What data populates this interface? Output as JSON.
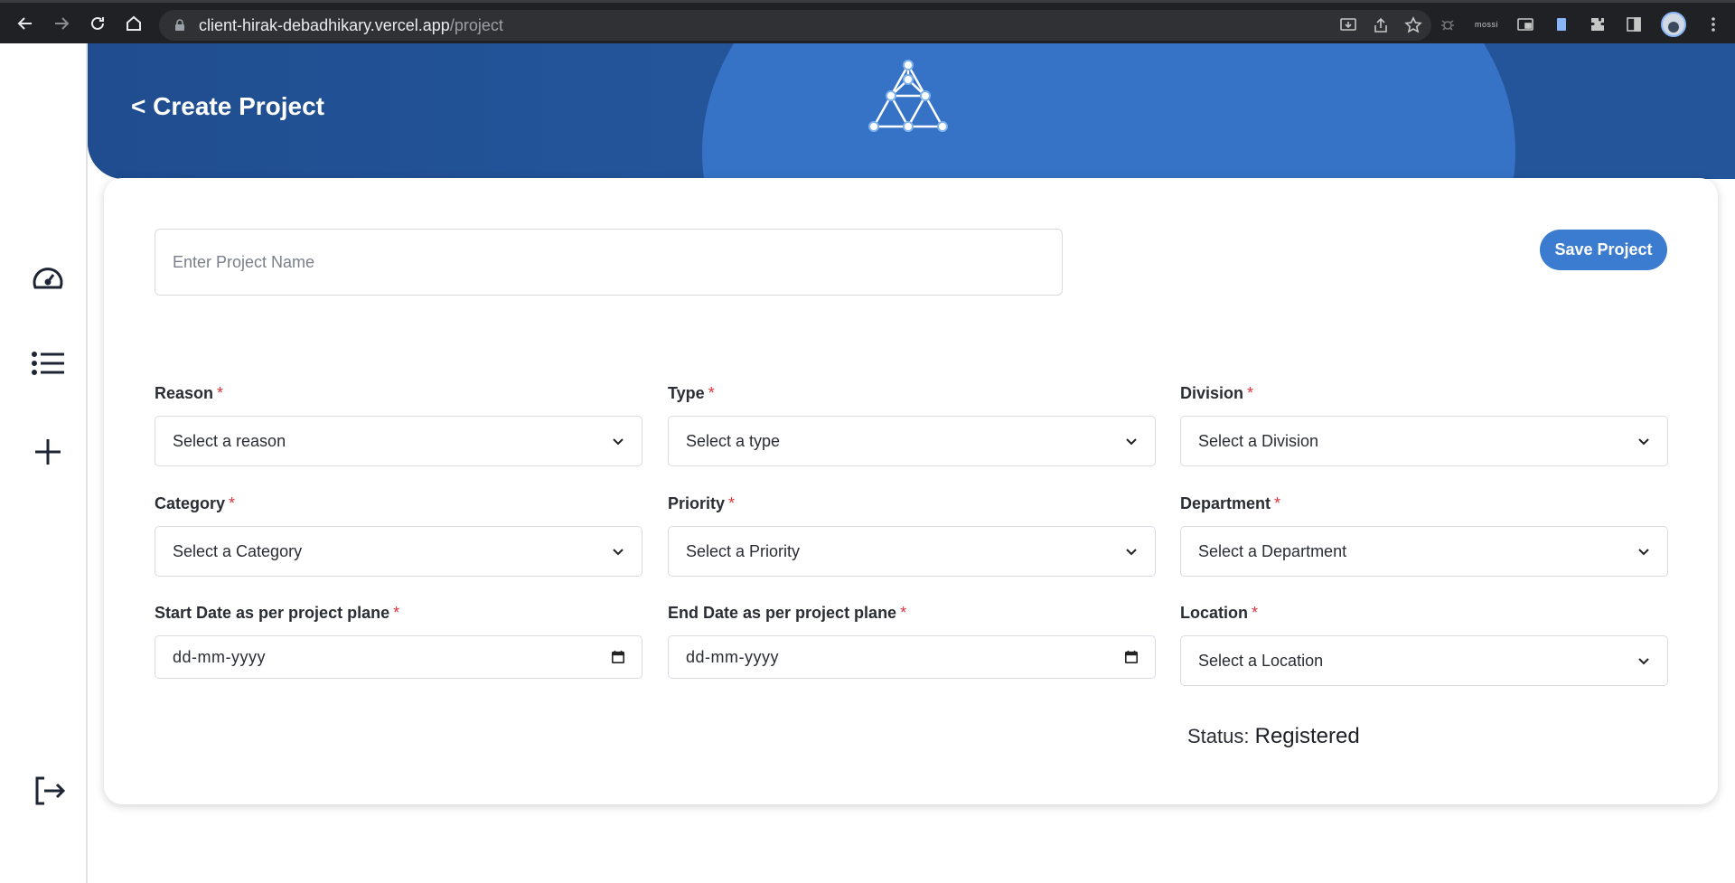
{
  "browser": {
    "url_host": "client-hirak-debadhikary.vercel.app",
    "url_path": "/project",
    "ext_label": "mossi"
  },
  "sidebar": {
    "items": [
      {
        "icon": "dashboard-gauge-icon"
      },
      {
        "icon": "list-icon"
      },
      {
        "icon": "plus-icon"
      },
      {
        "icon": "logout-icon"
      }
    ]
  },
  "header": {
    "title": "< Create Project",
    "colors": {
      "banner": "#24559b",
      "circle": "#3673c6"
    }
  },
  "form": {
    "project_name_placeholder": "Enter Project Name",
    "save_label": "Save Project",
    "required_mark": "*",
    "fields": {
      "reason": {
        "label": "Reason",
        "value": "Select a reason"
      },
      "type": {
        "label": "Type",
        "value": "Select a type"
      },
      "division": {
        "label": "Division",
        "value": "Select a Division"
      },
      "category": {
        "label": "Category",
        "value": "Select a Category"
      },
      "priority": {
        "label": "Priority",
        "value": "Select a Priority"
      },
      "department": {
        "label": "Department",
        "value": "Select a Department"
      },
      "start_date": {
        "label": "Start Date as per project plane",
        "value": "dd-mm-yyyy"
      },
      "end_date": {
        "label": "End Date as per project plane",
        "value": "dd-mm-yyyy"
      },
      "location": {
        "label": "Location",
        "value": "Select a Location"
      }
    },
    "status_label": "Status:",
    "status_value": "Registered"
  },
  "colors": {
    "accent": "#3b7bd0",
    "required": "#d9363e"
  }
}
